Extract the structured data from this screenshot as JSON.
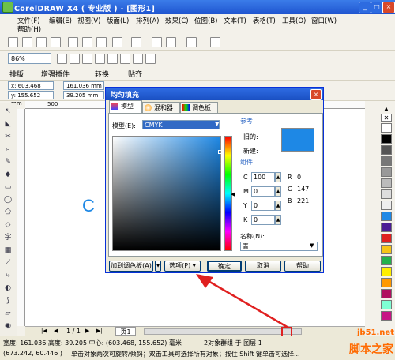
{
  "window": {
    "title": "CorelDRAW X4 ( 专业版 ) - [图形1]"
  },
  "menu": {
    "file": "文件(F)",
    "edit": "编辑(E)",
    "view": "视图(V)",
    "layout": "版面(L)",
    "arrange": "排列(A)",
    "effects": "效果(C)",
    "bitmaps": "位图(B)",
    "text": "文本(T)",
    "table": "表格(T)",
    "tools": "工具(O)",
    "window": "窗口(W)",
    "help": "帮助(H)"
  },
  "toolbar": {
    "zoom": "86%"
  },
  "propbar": {
    "arrange": "排版",
    "plugin": "增强插件",
    "convert": "转换",
    "snap": "贴齐"
  },
  "props": {
    "x": "x: 603.468 mm",
    "y": "y: 155.652 mm",
    "w": "161.036 mm",
    "h": "39.205 mm"
  },
  "ruler": {
    "mark500": "500"
  },
  "canvas": {
    "text": "C"
  },
  "dialog": {
    "title": "均匀填充",
    "tabs": [
      "模型",
      "混和器",
      "调色板"
    ],
    "model_label": "模型(E):",
    "model_value": "CMYK",
    "ref_label": "参考",
    "old_label": "旧的:",
    "new_label": "新建:",
    "comp_label": "组件",
    "c_label": "C",
    "c_val": "100",
    "m_label": "M",
    "m_val": "0",
    "y_label": "Y",
    "y_val": "0",
    "k_label": "K",
    "k_val": "0",
    "r_label": "R",
    "r_val": "0",
    "g_label": "G",
    "g_val": "147",
    "b_label": "B",
    "b_val": "221",
    "name_label": "名称(N):",
    "name_value": "青",
    "btn_add": "加到调色板(A)",
    "btn_options": "选项(P)",
    "btn_ok": "确定",
    "btn_cancel": "取消",
    "btn_help": "帮助",
    "old_color": "#1e88e5",
    "new_color": "#1e88e5"
  },
  "pages": {
    "nav": "1 / 1",
    "tab": "页1"
  },
  "status": {
    "line1": "宽度: 161.036 高度: 39.205 中心: (603.468, 155.652) 毫米",
    "line1b": "2对象群组 于 图层 1",
    "line2": "(673.242, 60.446 )",
    "line2b": "单击对象两次可旋转/倾斜；双击工具可选择所有对象；按住 Shift 键单击可选择..."
  },
  "watermark": {
    "site": "jb51.net",
    "name": "脚本之家"
  },
  "palette_colors": [
    "#ffffff",
    "#000000",
    "#555555",
    "#777777",
    "#999999",
    "#bbbbbb",
    "#dddddd",
    "#eeeeee",
    "#1e88e5",
    "#4c1d95",
    "#e02020",
    "#f5c518",
    "#22b14c",
    "#ffee00",
    "#ff9900",
    "#b01060",
    "#7fffd4",
    "#c71585"
  ]
}
